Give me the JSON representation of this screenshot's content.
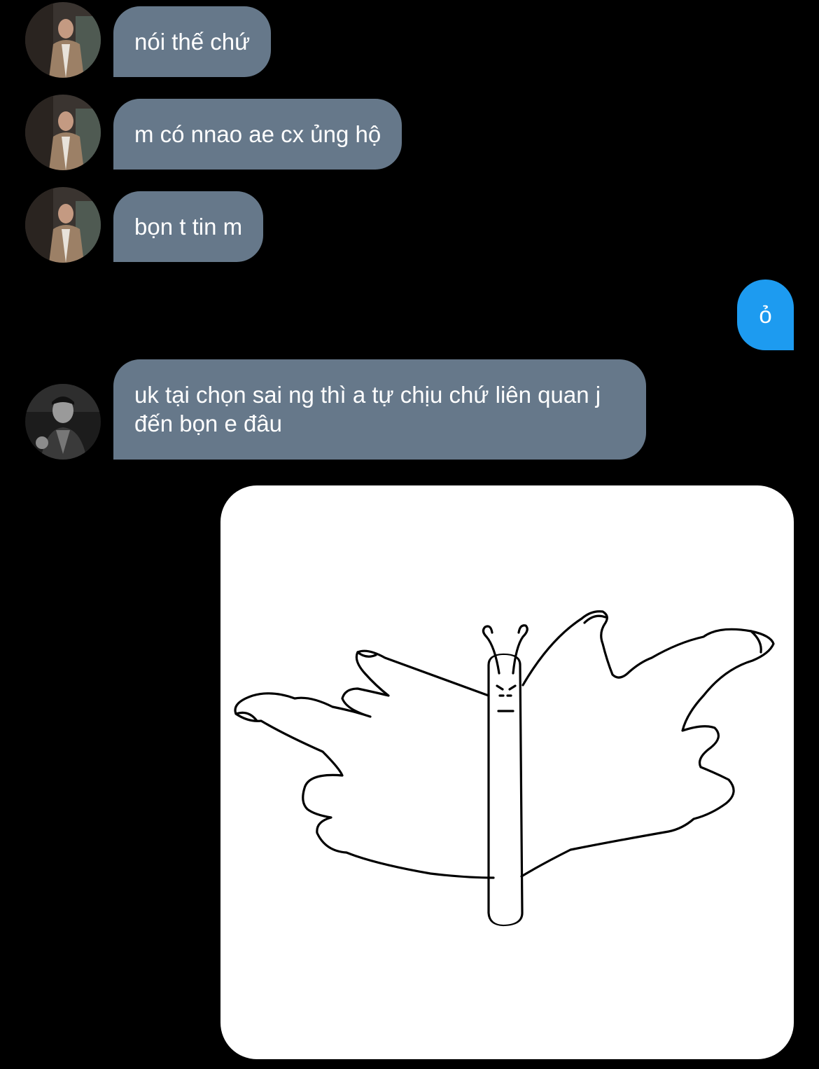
{
  "conversation": {
    "messages": [
      {
        "direction": "incoming",
        "text": "nói thế chứ"
      },
      {
        "direction": "incoming",
        "text": "m có nnao ae cx ủng hộ"
      },
      {
        "direction": "incoming",
        "text": "bọn t tin m"
      },
      {
        "direction": "outgoing",
        "text": "ỏ"
      },
      {
        "direction": "incoming",
        "text": "uk tại chọn sai ng thì a tự chịu chứ liên quan j đến bọn e đâu"
      },
      {
        "direction": "outgoing",
        "type": "image",
        "image": "hand-butterfly-drawing"
      }
    ]
  },
  "colors": {
    "background": "#000000",
    "incoming_bubble": "#66788a",
    "outgoing_bubble": "#1d9bf0",
    "text": "#ffffff"
  }
}
